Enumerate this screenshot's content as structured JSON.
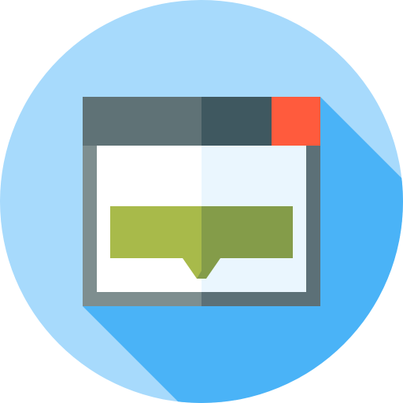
{
  "icon": {
    "name": "browser-window-tooltip-icon",
    "colors": {
      "background_circle": "#A7DAFC",
      "long_shadow": "#4AB3F7",
      "frame_left": "#7E8E8F",
      "frame_right": "#5C7077",
      "titlebar_left": "#5F7276",
      "titlebar_right": "#3F5860",
      "close_button": "#FF5B3D",
      "content_left": "#FFFFFF",
      "content_right": "#EAF6FE",
      "tooltip_left": "#A8BA4A",
      "tooltip_right": "#849C49"
    }
  }
}
